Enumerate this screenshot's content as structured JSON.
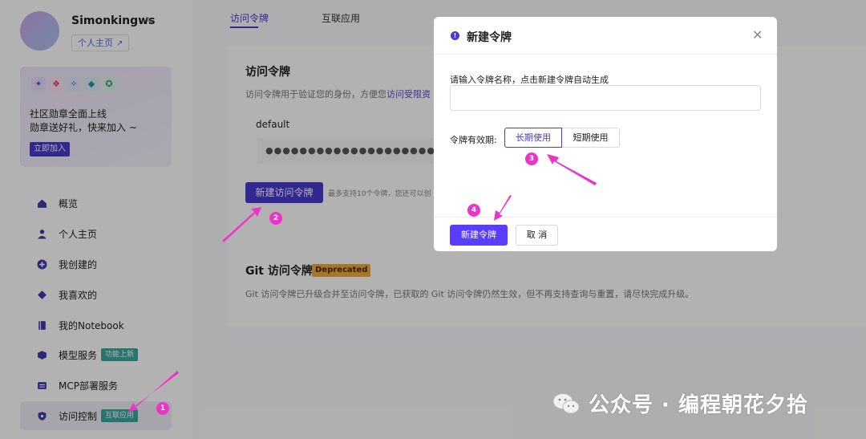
{
  "user": {
    "name": "Simonkingws",
    "home_link": "个人主页"
  },
  "promo": {
    "line1": "社区勋章全面上线",
    "line2": "勋章送好礼，快来加入 ~",
    "join_button": "立即加入"
  },
  "nav": {
    "items": [
      {
        "label": "概览",
        "icon": "home-icon"
      },
      {
        "label": "个人主页",
        "icon": "user-icon"
      },
      {
        "label": "我创建的",
        "icon": "plus-circle-icon"
      },
      {
        "label": "我喜欢的",
        "icon": "diamond-icon"
      },
      {
        "label": "我的Notebook",
        "icon": "notebook-icon"
      },
      {
        "label": "模型服务",
        "icon": "cube-icon",
        "tag": "功能上新"
      },
      {
        "label": "MCP部署服务",
        "icon": "server-icon"
      },
      {
        "label": "访问控制",
        "icon": "shield-icon",
        "tag": "互联应用"
      }
    ]
  },
  "tabs": [
    "访问令牌",
    "互联应用"
  ],
  "access_tokens": {
    "title": "访问令牌",
    "desc_prefix": "访问令牌用于验证您的身份，方便您",
    "desc_link": "访问受限资",
    "token_name": "default",
    "token_masked": "●●●●●●●●●●●●●●●●●●●●●●●●●●●●●●●●",
    "new_button": "新建访问令牌",
    "hint": "最多支持10个令牌，您还可以创"
  },
  "git_tokens": {
    "title": "Git 访问令牌",
    "badge": "Deprecated",
    "desc": "Git 访问令牌已升级合并至访问令牌，已获取的 Git 访问令牌仍然生效，但不再支持查询与重置，请尽快完成升级。"
  },
  "modal": {
    "title": "新建令牌",
    "name_label": "请输入令牌名称，点击新建令牌自动生成",
    "name_value": "",
    "name_placeholder": "",
    "validity_label": "令牌有效期:",
    "options": [
      "长期使用",
      "短期使用"
    ],
    "selected_option": "长期使用",
    "create_button": "新建令牌",
    "cancel_button": "取 消"
  },
  "steps": [
    "1",
    "2",
    "3",
    "4"
  ],
  "watermark": "公众号 · 编程朝花夕拾",
  "colors": {
    "accent": "#4a3ad0",
    "annotation": "#ee33c9",
    "tag": "#3aa6a0",
    "deprecated": "#f3a93a"
  }
}
